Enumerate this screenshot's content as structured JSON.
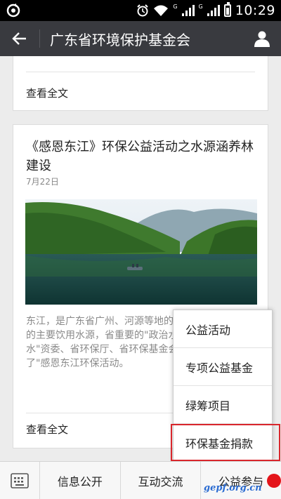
{
  "status_bar": {
    "clock": "10:29",
    "net1": "G",
    "net2": "G",
    "icons": [
      "refresh-icon",
      "alarm-icon",
      "wifi-icon",
      "signal-icon",
      "signal-icon",
      "battery-icon"
    ]
  },
  "nav": {
    "title": "广东省环境保护基金会",
    "back_icon": "arrow-left-icon",
    "user_icon": "person-icon"
  },
  "articles": [
    {
      "readmore": "查看全文"
    },
    {
      "title": "《感恩东江》环保公益活动之水源涵养林建设",
      "date": "7月22日",
      "excerpt": "东江，是广东省广州、河源等地的4000多万城乡居民的主要饮用水源，省重要的\"政治水、经济水、生命水\"资委、省环保厅、省环保基金会于2013年启动了\"感恩东江环保活动。",
      "readmore": "查看全文"
    }
  ],
  "popup_menu": {
    "items": [
      "公益活动",
      "专项公益基金",
      "绿筹项目",
      "环保基金捐款"
    ],
    "highlight_color": "#d9262c"
  },
  "tab_bar": {
    "keyboard_icon": "keyboard-icon",
    "tabs": [
      "信息公开",
      "互动交流",
      "公益参与"
    ]
  },
  "watermark": "gepf.org.cn",
  "colors": {
    "navbar": "#393a3f",
    "badge": "#e4151a"
  }
}
